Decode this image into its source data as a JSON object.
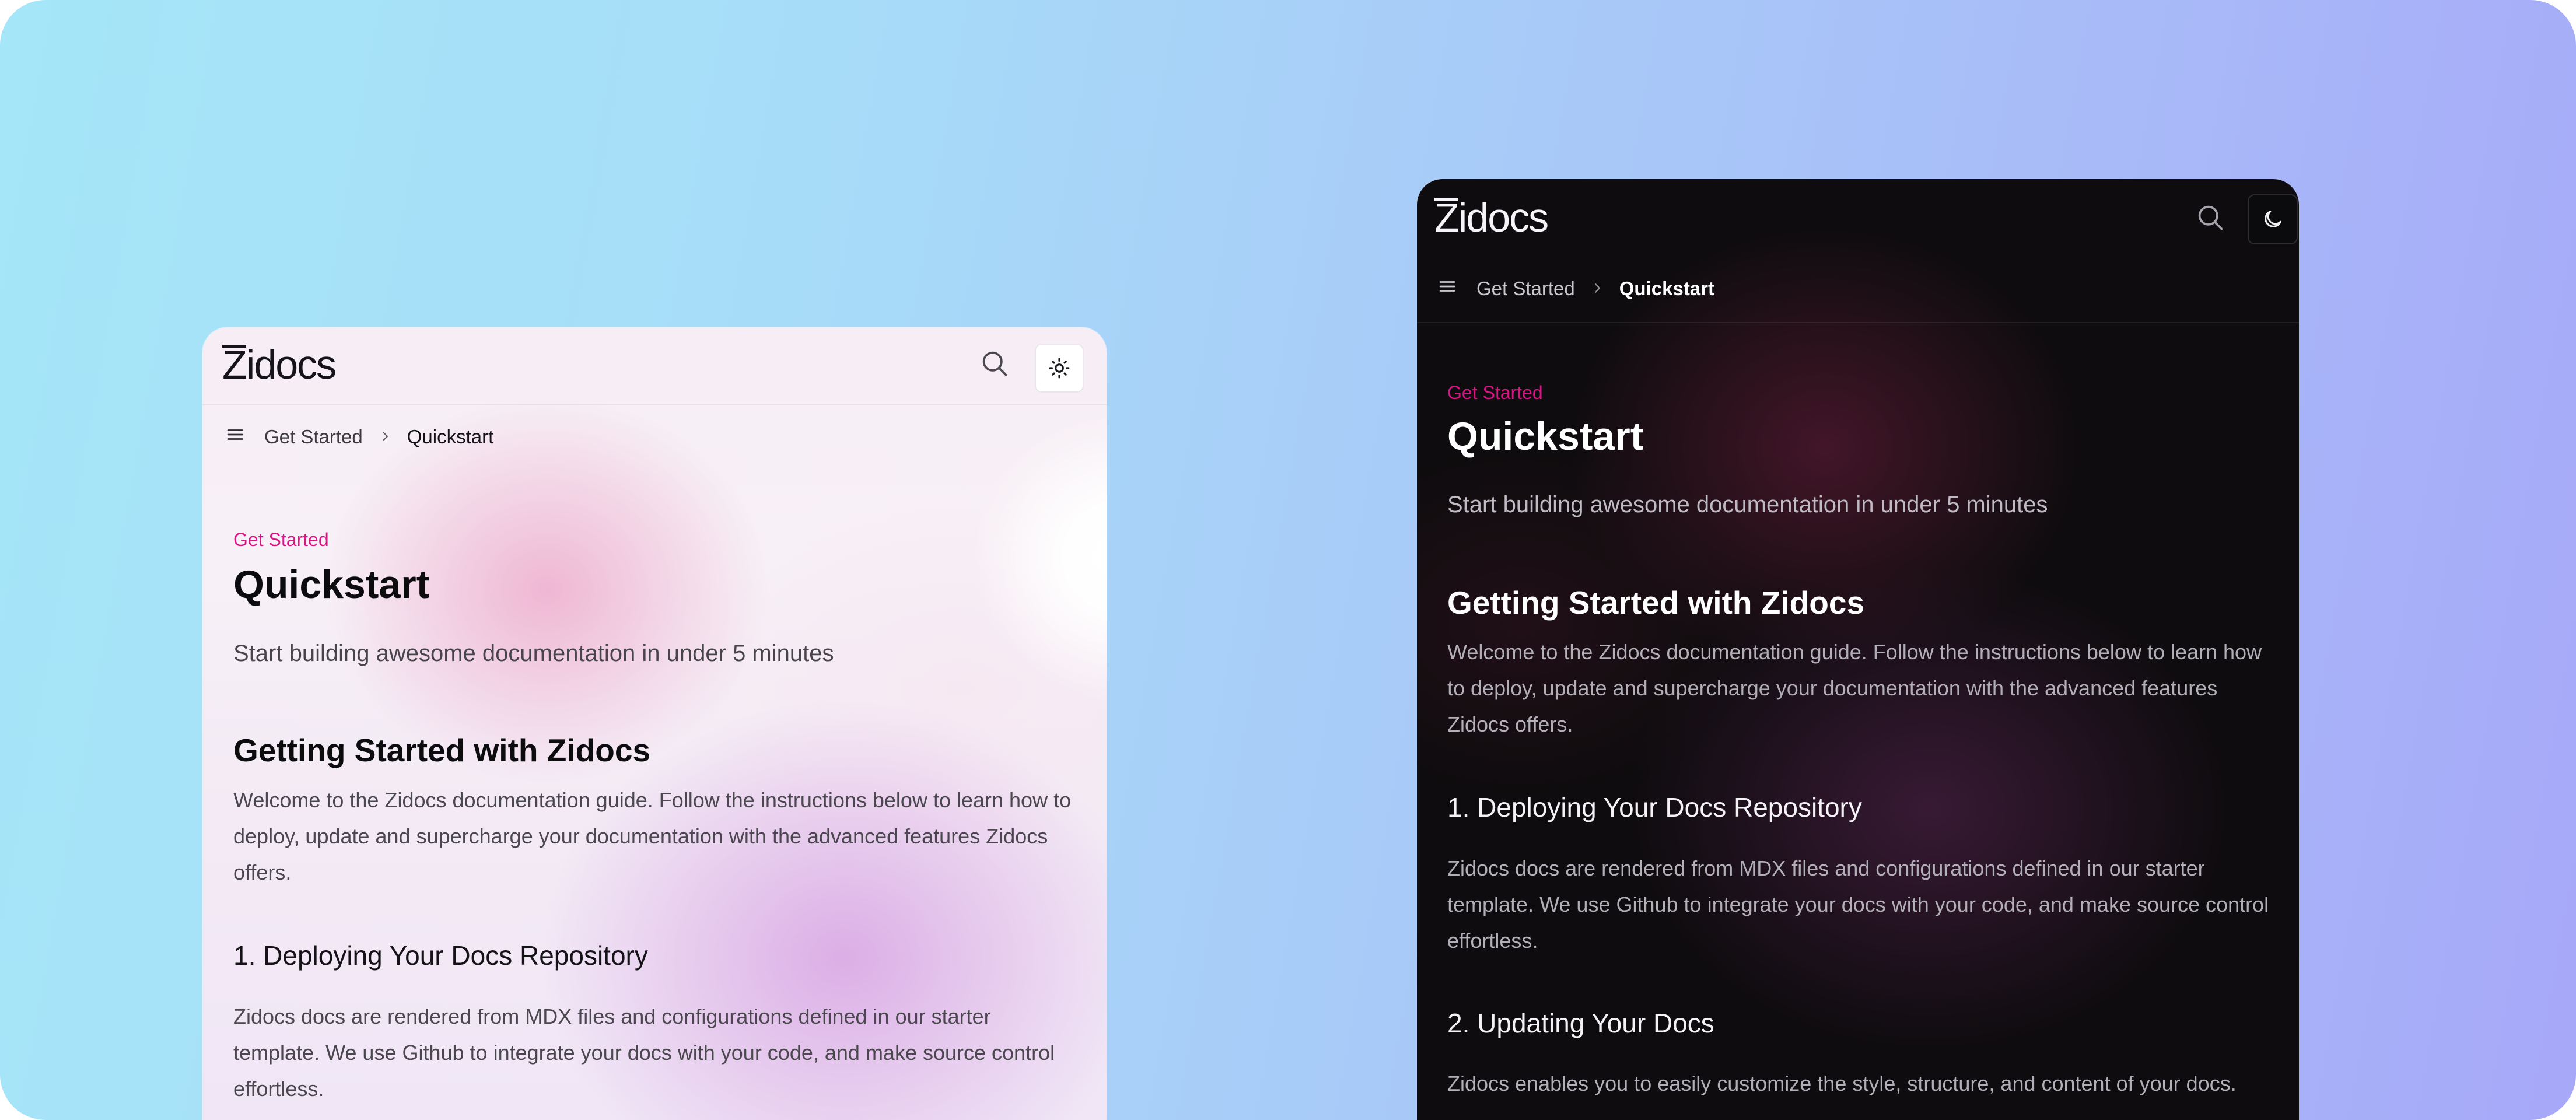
{
  "colors": {
    "accent": "#db1485",
    "background_gradient": [
      "#a5e6f8",
      "#a7a8f8"
    ],
    "light_surface": "#f6eef4",
    "dark_surface": "#0e0c0e"
  },
  "light_window": {
    "logo": "Zidocs",
    "icons": [
      "search-icon",
      "sun-icon",
      "menu-icon",
      "chevron-right-icon"
    ],
    "breadcrumb": [
      "Get Started",
      "Quickstart"
    ],
    "eyebrow": "Get Started",
    "title": "Quickstart",
    "lead": "Start building awesome documentation in under 5 minutes",
    "section_title": "Getting Started with Zidocs",
    "intro": "Welcome to the Zidocs documentation guide. Follow the instructions below to learn how to deploy, update and supercharge your documentation with the advanced features Zidocs offers.",
    "step1_title": "1. Deploying Your Docs Repository",
    "step1_text": "Zidocs docs are rendered from MDX files and configurations defined in our starter template. We use Github to integrate your docs with your code, and make source control effortless."
  },
  "dark_window": {
    "logo": "Zidocs",
    "icons": [
      "search-icon",
      "moon-icon",
      "menu-icon",
      "chevron-right-icon"
    ],
    "breadcrumb": [
      "Get Started",
      "Quickstart"
    ],
    "eyebrow": "Get Started",
    "title": "Quickstart",
    "lead": "Start building awesome documentation in under 5 minutes",
    "section_title": "Getting Started with Zidocs",
    "intro": "Welcome to the Zidocs documentation guide. Follow the instructions below to learn how to deploy, update and supercharge your documentation with the advanced features Zidocs offers.",
    "step1_title": "1. Deploying Your Docs Repository",
    "step1_text": "Zidocs docs are rendered from MDX files and configurations defined in our starter template. We use Github to integrate your docs with your code, and make source control effortless.",
    "step2_title": "2. Updating Your Docs",
    "step2_text": "Zidocs enables you to easily customize the style, structure, and content of your docs."
  }
}
